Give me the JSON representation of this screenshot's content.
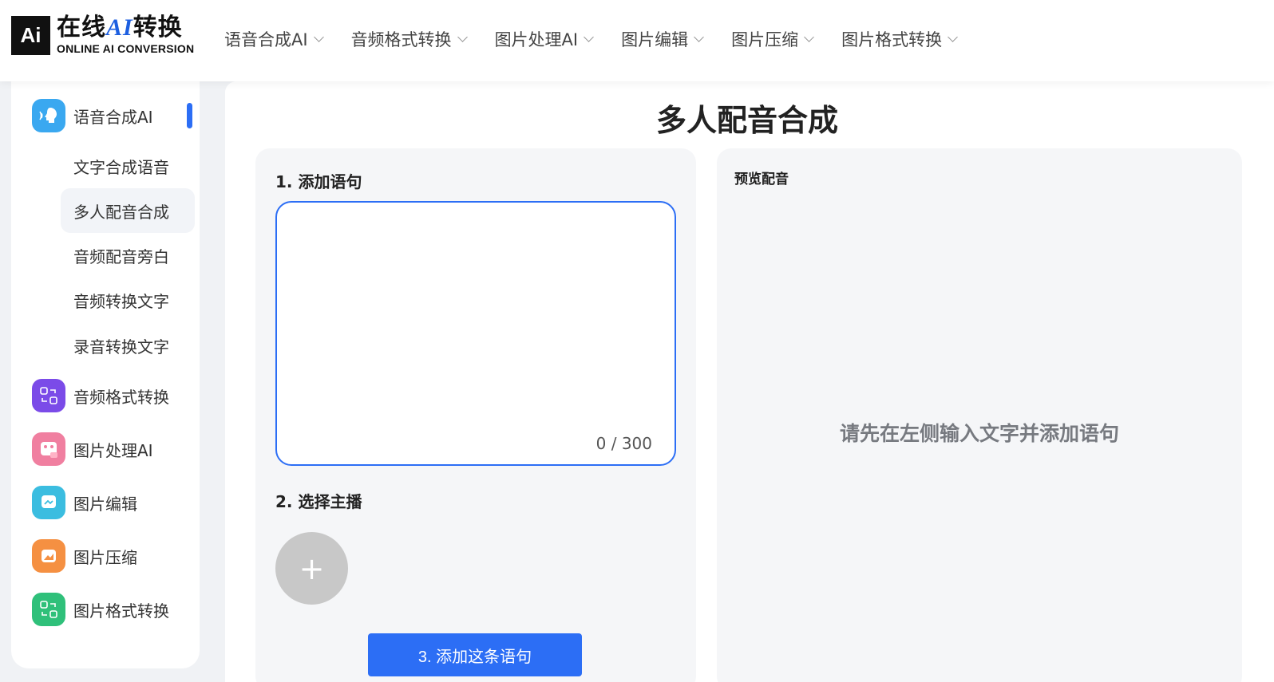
{
  "logo": {
    "box_text": "Ai",
    "title_prefix": "在线",
    "title_ai": "AI",
    "title_suffix": "转换",
    "subtitle": "ONLINE AI CONVERSION"
  },
  "nav": {
    "items": [
      "语音合成AI",
      "音频格式转换",
      "图片处理AI",
      "图片编辑",
      "图片压缩",
      "图片格式转换"
    ]
  },
  "sidebar": {
    "groups": [
      {
        "label": "语音合成AI",
        "icon": "voice-icon",
        "color": "#3aa8f0"
      },
      {
        "label": "音频格式转换",
        "icon": "audio-convert-icon",
        "color": "#7b4be8"
      },
      {
        "label": "图片处理AI",
        "icon": "image-ai-icon",
        "color": "#f07fa0"
      },
      {
        "label": "图片编辑",
        "icon": "image-edit-icon",
        "color": "#3bbde0"
      },
      {
        "label": "图片压缩",
        "icon": "image-compress-icon",
        "color": "#f59042"
      },
      {
        "label": "图片格式转换",
        "icon": "image-convert-icon",
        "color": "#2fc07a"
      }
    ],
    "sub_items": [
      "文字合成语音",
      "多人配音合成",
      "音频配音旁白",
      "音频转换文字",
      "录音转换文字"
    ],
    "active_sub": "多人配音合成"
  },
  "main": {
    "title": "多人配音合成",
    "step1": "1. 添加语句",
    "textarea_value": "",
    "counter": "0 / 300",
    "step2": "2. 选择主播",
    "add_anchor": "+",
    "add_button": "3. 添加这条语句",
    "preview_title": "预览配音",
    "preview_hint": "请先在左侧输入文字并添加语句"
  },
  "colors": {
    "accent": "#2c6ef5",
    "panel_bg": "#f5f6f8"
  }
}
